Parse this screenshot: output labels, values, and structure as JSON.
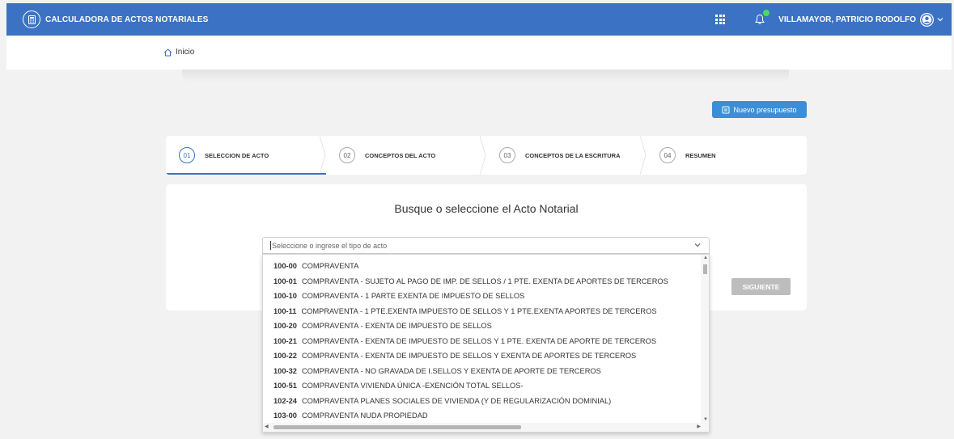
{
  "app": {
    "title": "CALCULADORA DE ACTOS NOTARIALES",
    "user_name": "VILLAMAYOR, PATRICIO RODOLFO",
    "accent": "#3b72c4",
    "notification_dot": "#4cd964"
  },
  "breadcrumb": {
    "home_label": "Inicio"
  },
  "actions": {
    "new_budget_label": "Nuevo presupuesto",
    "next_label": "SIGUIENTE"
  },
  "stepper": {
    "steps": [
      {
        "num": "01",
        "label": "SELECCION DE ACTO",
        "active": true
      },
      {
        "num": "02",
        "label": "CONCEPTOS DEL ACTO",
        "active": false
      },
      {
        "num": "03",
        "label": "CONCEPTOS DE LA ESCRITURA",
        "active": false
      },
      {
        "num": "04",
        "label": "RESUMEN",
        "active": false
      }
    ]
  },
  "card": {
    "title": "Busque o seleccione el Acto Notarial"
  },
  "select": {
    "placeholder": "Seleccione o ingrese el tipo de acto",
    "options": [
      {
        "code": "100-00",
        "label": "COMPRAVENTA"
      },
      {
        "code": "100-01",
        "label": "COMPRAVENTA - SUJETO AL PAGO DE IMP. DE SELLOS / 1 PTE. EXENTA DE APORTES DE TERCEROS"
      },
      {
        "code": "100-10",
        "label": "COMPRAVENTA - 1 PARTE EXENTA DE IMPUESTO DE SELLOS"
      },
      {
        "code": "100-11",
        "label": "COMPRAVENTA - 1 PTE.EXENTA IMPUESTO DE SELLOS Y 1 PTE.EXENTA APORTES DE TERCEROS"
      },
      {
        "code": "100-20",
        "label": "COMPRAVENTA - EXENTA DE IMPUESTO DE SELLOS"
      },
      {
        "code": "100-21",
        "label": "COMPRAVENTA - EXENTA DE IMPUESTO DE SELLOS Y 1 PTE. EXENTA DE APORTE DE TERCEROS"
      },
      {
        "code": "100-22",
        "label": "COMPRAVENTA - EXENTA DE IMPUESTO DE SELLOS Y EXENTA DE APORTES DE TERCEROS"
      },
      {
        "code": "100-32",
        "label": "COMPRAVENTA - NO GRAVADA DE I.SELLOS Y EXENTA DE APORTE DE TERCEROS"
      },
      {
        "code": "100-51",
        "label": "COMPRAVENTA VIVIENDA ÚNICA -EXENCIÓN TOTAL SELLOS-"
      },
      {
        "code": "102-24",
        "label": "COMPRAVENTA PLANES SOCIALES DE VIVIENDA (Y DE REGULARIZACIÓN DOMINIAL)"
      },
      {
        "code": "103-00",
        "label": "COMPRAVENTA NUDA PROPIEDAD"
      }
    ]
  }
}
